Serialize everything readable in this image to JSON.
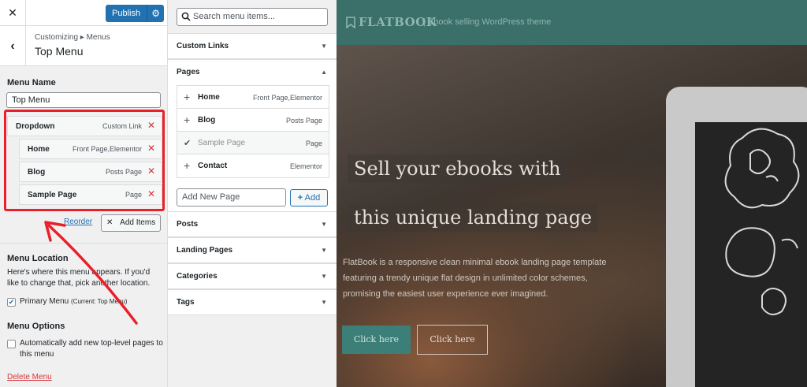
{
  "customizer": {
    "close_icon": "close-icon",
    "publish_label": "Publish",
    "breadcrumb": "Customizing ▸ Menus",
    "panel_title": "Top Menu",
    "menu_name_label": "Menu Name",
    "menu_name_value": "Top Menu",
    "menu_items": [
      {
        "title": "Dropdown",
        "type": "Custom Link"
      },
      {
        "title": "Home",
        "type": "Front Page,Elementor"
      },
      {
        "title": "Blog",
        "type": "Posts Page"
      },
      {
        "title": "Sample Page",
        "type": "Page"
      }
    ],
    "reorder_label": "Reorder",
    "add_items_label": "Add Items",
    "location_heading": "Menu Location",
    "location_help": "Here's where this menu appears. If you'd like to change that, pick another location.",
    "primary_menu_label": "Primary Menu",
    "primary_menu_current": "(Current: Top Menu)",
    "primary_menu_checked": true,
    "options_heading": "Menu Options",
    "auto_add_label": "Automatically add new top-level pages to this menu",
    "auto_add_checked": false,
    "delete_menu_label": "Delete Menu",
    "accent_color": "#2271b1",
    "highlight_color": "#e8202a"
  },
  "add_panel": {
    "search_placeholder": "Search menu items...",
    "sections": {
      "custom_links": "Custom Links",
      "pages": "Pages",
      "posts": "Posts",
      "landing_pages": "Landing Pages",
      "categories": "Categories",
      "tags": "Tags"
    },
    "pages": [
      {
        "title": "Home",
        "type": "Front Page,Elementor",
        "added": false
      },
      {
        "title": "Blog",
        "type": "Posts Page",
        "added": false
      },
      {
        "title": "Sample Page",
        "type": "Page",
        "added": true
      },
      {
        "title": "Contact",
        "type": "Elementor",
        "added": false
      }
    ],
    "new_page_placeholder": "Add New Page",
    "add_label": "Add"
  },
  "preview": {
    "logo": "FLATBOOK",
    "tagline": "| Ebook selling WordPress theme",
    "headline_1": "Sell your ebooks with",
    "headline_2": "this unique landing page",
    "description": "FlatBook is a responsive clean minimal ebook landing page template featuring a trendy unique flat design in unlimited color schemes, promising the easiest user experience ever imagined.",
    "cta_primary": "Click here",
    "cta_secondary": "Click here",
    "header_color": "#3b6f69"
  }
}
